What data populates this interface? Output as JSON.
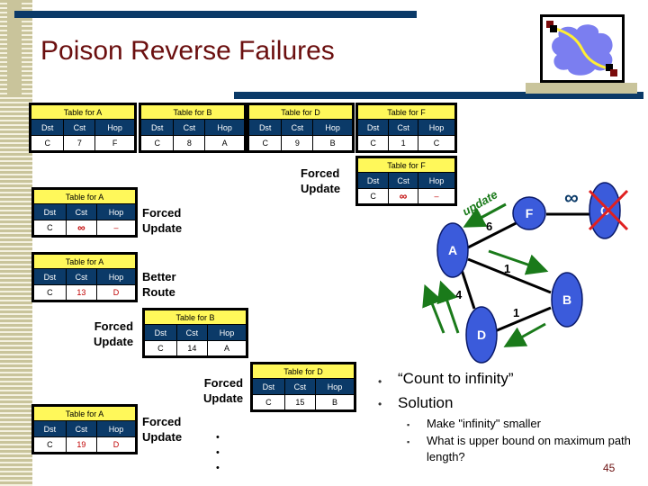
{
  "slide": {
    "title": "Poison Reverse Failures",
    "page_number": "45",
    "logo_icon": "network-cloud-icon"
  },
  "table_headers": {
    "dst": "Dst",
    "cst": "Cst",
    "hop": "Hop"
  },
  "tables": [
    {
      "caption": "Table for A",
      "dst": "C",
      "cst": "7",
      "hop": "F"
    },
    {
      "caption": "Table for B",
      "dst": "C",
      "cst": "8",
      "hop": "A"
    },
    {
      "caption": "Table for D",
      "dst": "C",
      "cst": "9",
      "hop": "B"
    },
    {
      "caption": "Table for F",
      "dst": "C",
      "cst": "1",
      "hop": "C"
    },
    {
      "caption": "Table for F",
      "dst": "C",
      "cst": "∞",
      "hop": "–"
    },
    {
      "caption": "Table for A",
      "dst": "C",
      "cst": "∞",
      "hop": "–"
    },
    {
      "caption": "Table for A",
      "dst": "C",
      "cst": "13",
      "hop": "D"
    },
    {
      "caption": "Table for B",
      "dst": "C",
      "cst": "14",
      "hop": "A"
    },
    {
      "caption": "Table for D",
      "dst": "C",
      "cst": "15",
      "hop": "B"
    },
    {
      "caption": "Table for A",
      "dst": "C",
      "cst": "19",
      "hop": "D"
    }
  ],
  "labels": {
    "forced_update_1": [
      "Forced",
      "Update"
    ],
    "forced_update_2": [
      "Forced",
      "Update"
    ],
    "better_route": [
      "Better",
      "Route"
    ],
    "forced_update_3": [
      "Forced",
      "Update"
    ],
    "forced_update_4": [
      "Forced",
      "Update"
    ],
    "forced_update_5": [
      "Forced",
      "Update"
    ],
    "ellipsis": [
      "•",
      "•",
      "•"
    ]
  },
  "diagram": {
    "nodes": [
      "A",
      "B",
      "C",
      "D",
      "F"
    ],
    "edges": [
      {
        "from": "A",
        "to": "F",
        "cost": "6"
      },
      {
        "from": "F",
        "to": "C",
        "cost": "∞"
      },
      {
        "from": "A",
        "to": "B",
        "cost": "1"
      },
      {
        "from": "A",
        "to": "D",
        "cost": "4"
      },
      {
        "from": "D",
        "to": "B",
        "cost": "1"
      }
    ],
    "update_label": "update",
    "failed_node": "C",
    "colors": {
      "node": "#3b5bdb",
      "arrow": "#1a7a1a",
      "cross": "#e02020"
    }
  },
  "bullets": [
    {
      "text": "“Count to infinity”"
    },
    {
      "text": "Solution",
      "children": [
        "Make \"infinity\" smaller",
        "What is upper bound on maximum path length?"
      ]
    }
  ]
}
